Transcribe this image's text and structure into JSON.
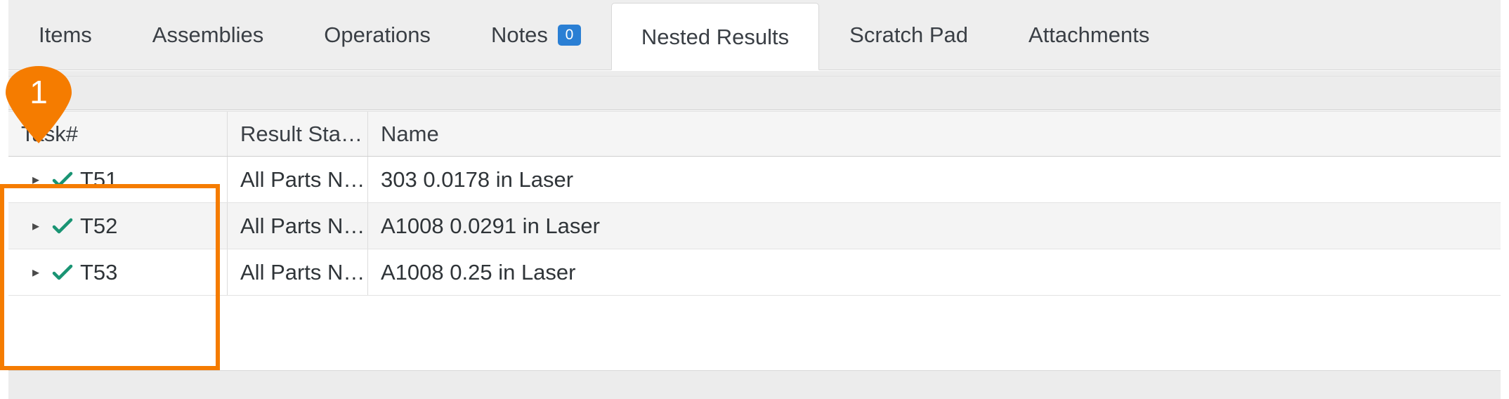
{
  "tabs": [
    {
      "id": "items",
      "label": "Items",
      "active": false,
      "badge": null
    },
    {
      "id": "assemblies",
      "label": "Assemblies",
      "active": false,
      "badge": null
    },
    {
      "id": "operations",
      "label": "Operations",
      "active": false,
      "badge": null
    },
    {
      "id": "notes",
      "label": "Notes",
      "active": false,
      "badge": "0"
    },
    {
      "id": "nested-results",
      "label": "Nested Results",
      "active": true,
      "badge": null
    },
    {
      "id": "scratch-pad",
      "label": "Scratch Pad",
      "active": false,
      "badge": null
    },
    {
      "id": "attachments",
      "label": "Attachments",
      "active": false,
      "badge": null
    }
  ],
  "grid": {
    "columns": [
      {
        "id": "task",
        "label": "Task#"
      },
      {
        "id": "status",
        "label": "Result Sta…"
      },
      {
        "id": "name",
        "label": "Name"
      }
    ],
    "rows": [
      {
        "expander": "▸",
        "status_icon": "check-icon",
        "task": "T51",
        "result_status": "All Parts N…",
        "name": "303 0.0178 in Laser"
      },
      {
        "expander": "▸",
        "status_icon": "check-icon",
        "task": "T52",
        "result_status": "All Parts N…",
        "name": "A1008 0.0291 in Laser"
      },
      {
        "expander": "▸",
        "status_icon": "check-icon",
        "task": "T53",
        "result_status": "All Parts N…",
        "name": "A1008 0.25 in Laser"
      }
    ]
  },
  "annotation": {
    "step_number": "1",
    "pin_color": "#f57c00",
    "highlight_color": "#f57c00"
  },
  "colors": {
    "tabbar_bg": "#eeeeee",
    "active_tab_bg": "#ffffff",
    "badge_bg": "#2a7fd4",
    "check_green": "#199473",
    "text": "#3a3f45",
    "row_alt_bg": "#f4f4f4",
    "header_bg": "#f5f5f5"
  }
}
